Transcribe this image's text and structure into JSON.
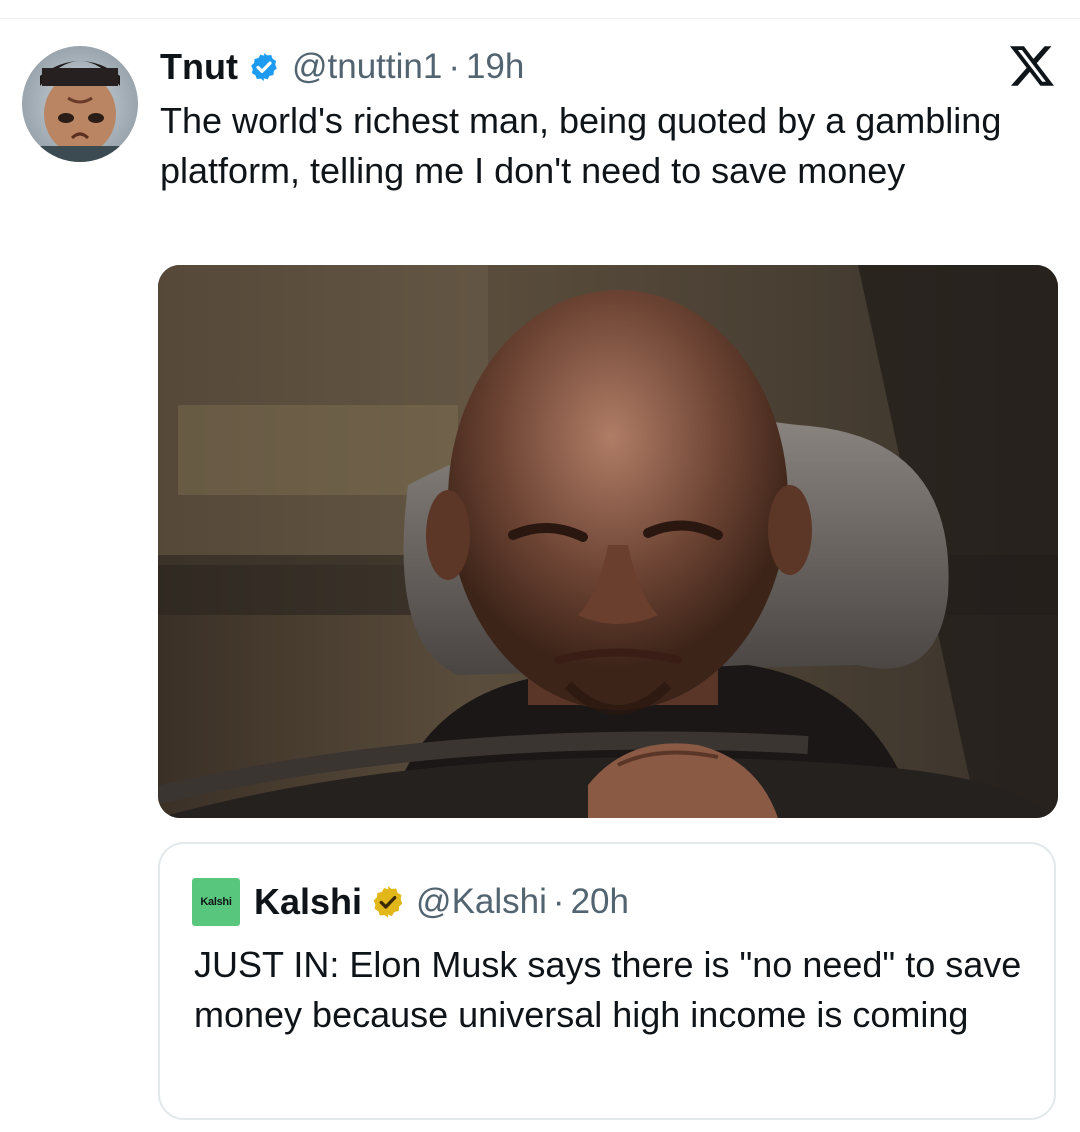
{
  "tweet": {
    "author_name": "Tnut",
    "handle": "@tnuttin1",
    "separator": "·",
    "time": "19h",
    "text": "The world's richest man, being quoted by a gambling platform, telling me I don't need to save money",
    "verified_color": "#1d9bf0"
  },
  "platform": {
    "logo_icon": "x-logo-icon"
  },
  "quote": {
    "avatar_text": "Kalshi",
    "avatar_color": "#58c77d",
    "author_name": "Kalshi",
    "handle": "@Kalshi",
    "separator": "·",
    "time": "20h",
    "text": "JUST IN: Elon Musk says there is \"no need\" to save money because universal high income is coming",
    "verified_color": "#e2b719"
  },
  "colors": {
    "text_primary": "#0f1419",
    "text_secondary": "#536471",
    "border": "#e3e8eb"
  }
}
